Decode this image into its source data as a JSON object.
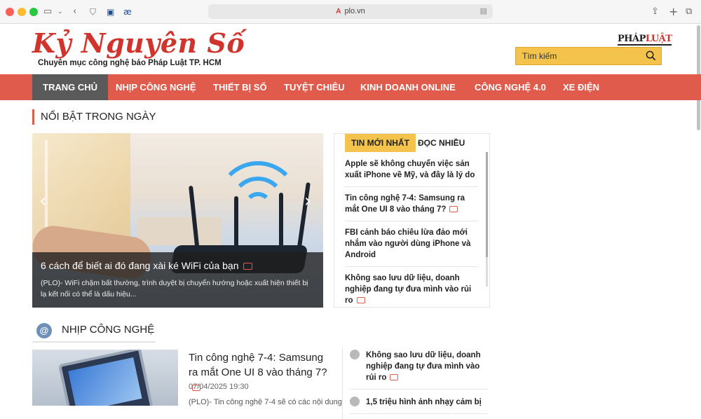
{
  "browser": {
    "url": "plo.vn",
    "favicon": "A"
  },
  "site": {
    "logo": "Kỷ Nguyên Số",
    "tagline": "Chuyên mục công nghệ báo Pháp Luật TP. HCM",
    "brand_a": "PHÁP",
    "brand_b": "LUẬT",
    "search_placeholder": "Tìm kiếm"
  },
  "nav": [
    "TRANG CHỦ",
    "NHỊP CÔNG NGHỆ",
    "THIẾT BỊ SỐ",
    "TUYỆT CHIÊU",
    "KINH DOANH ONLINE",
    "CÔNG NGHỆ 4.0",
    "XE ĐIỆN"
  ],
  "featured": {
    "section_title": "NỔI BẬT TRONG NGÀY",
    "hero_title": "6 cách để biết ai đó đang xài ké WiFi của bạn",
    "hero_desc": "(PLO)- WiFi chậm bất thường, trình duyệt bị chuyển hướng hoặc xuất hiện thiết bị lạ kết nối có thể là dấu hiệu..."
  },
  "tabs": {
    "latest": "TIN MỚI NHẤT",
    "popular": "ĐỌC NHIỀU",
    "items": [
      "Apple sẽ không chuyển việc sản xuất iPhone về Mỹ, và đây là lý do",
      "Tin công nghệ 7-4: Samsung ra mắt One UI 8 vào tháng 7?",
      "FBI cảnh báo chiêu lừa đảo mới nhắm vào người dùng iPhone và Android",
      "Không sao lưu dữ liệu, doanh nghiệp đang tự đưa mình vào rủi ro"
    ]
  },
  "section2": {
    "icon_letter": "@",
    "title": "NHỊP CÔNG NGHỆ",
    "article_title": "Tin công nghệ 7-4: Samsung ra mắt One UI 8 vào tháng 7?",
    "article_date": "07/04/2025 19:30",
    "article_desc": "(PLO)- Tin công nghệ 7-4 sẽ có các nội dung",
    "side": [
      "Không sao lưu dữ liệu, doanh nghiệp đang tự đưa mình vào rủi ro",
      "1,5 triệu hình ảnh nhạy cảm bị"
    ]
  },
  "colors": {
    "accent": "#e15b4d",
    "active_nav": "#5a5a5a",
    "search_bg": "#f3c34b"
  }
}
